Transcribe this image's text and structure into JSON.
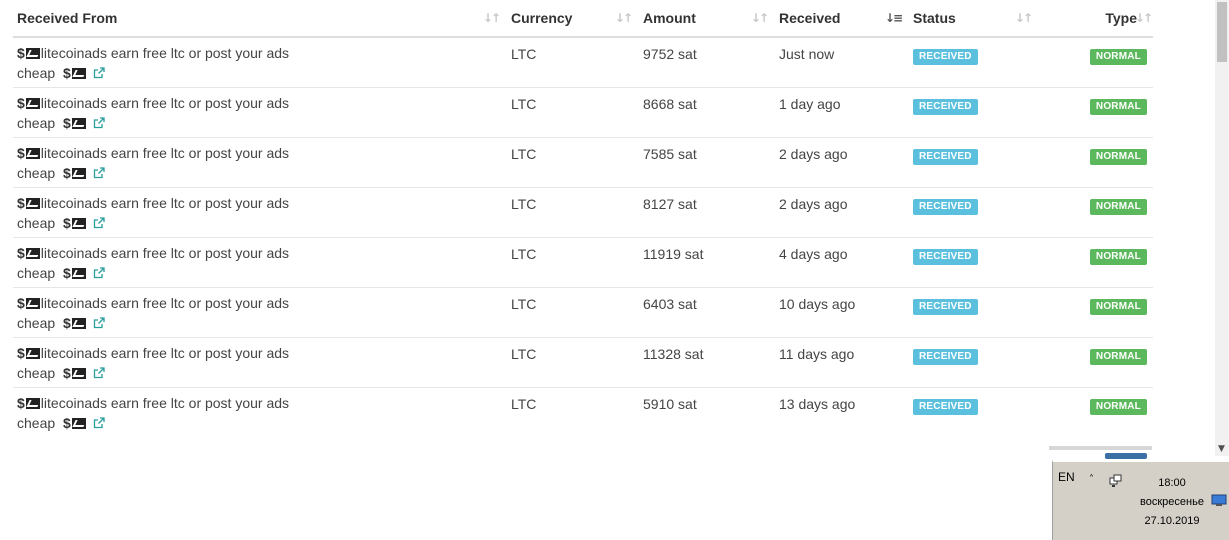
{
  "table": {
    "headers": {
      "from": "Received From",
      "currency": "Currency",
      "amount": "Amount",
      "received": "Received",
      "status": "Status",
      "type": "Type"
    },
    "rows": [
      {
        "line1": "litecoinads earn free ltc or post your ads",
        "line2": "cheap",
        "currency": "LTC",
        "amount": "9752 sat",
        "received": "Just now",
        "status": "RECEIVED",
        "type": "NORMAL"
      },
      {
        "line1": "litecoinads earn free ltc or post your ads",
        "line2": "cheap",
        "currency": "LTC",
        "amount": "8668 sat",
        "received": "1 day ago",
        "status": "RECEIVED",
        "type": "NORMAL"
      },
      {
        "line1": "litecoinads earn free ltc or post your ads",
        "line2": "cheap",
        "currency": "LTC",
        "amount": "7585 sat",
        "received": "2 days ago",
        "status": "RECEIVED",
        "type": "NORMAL"
      },
      {
        "line1": "litecoinads earn free ltc or post your ads",
        "line2": "cheap",
        "currency": "LTC",
        "amount": "8127 sat",
        "received": "2 days ago",
        "status": "RECEIVED",
        "type": "NORMAL"
      },
      {
        "line1": "litecoinads earn free ltc or post your ads",
        "line2": "cheap",
        "currency": "LTC",
        "amount": "11919 sat",
        "received": "4 days ago",
        "status": "RECEIVED",
        "type": "NORMAL"
      },
      {
        "line1": "litecoinads earn free ltc or post your ads",
        "line2": "cheap",
        "currency": "LTC",
        "amount": "6403 sat",
        "received": "10 days ago",
        "status": "RECEIVED",
        "type": "NORMAL"
      },
      {
        "line1": "litecoinads earn free ltc or post your ads",
        "line2": "cheap",
        "currency": "LTC",
        "amount": "11328 sat",
        "received": "11 days ago",
        "status": "RECEIVED",
        "type": "NORMAL"
      },
      {
        "line1": "litecoinads earn free ltc or post your ads",
        "line2": "cheap",
        "currency": "LTC",
        "amount": "5910 sat",
        "received": "13 days ago",
        "status": "RECEIVED",
        "type": "NORMAL"
      }
    ],
    "dollar_sign": "$",
    "sorted_column": "received",
    "sorted_direction": "descending"
  },
  "icons": {
    "sort": "sort-arrows-icon",
    "chart": "chart-icon",
    "external_link": "external-link-icon",
    "network": "network-icon",
    "show_desktop": "desktop-icon"
  },
  "colors": {
    "received_badge": "#5bc0de",
    "normal_badge": "#5cb85c",
    "tray_background": "#d4d0c8"
  },
  "taskbar": {
    "language": "EN",
    "time": "18:00",
    "day": "воскресенье",
    "date": "27.10.2019"
  }
}
